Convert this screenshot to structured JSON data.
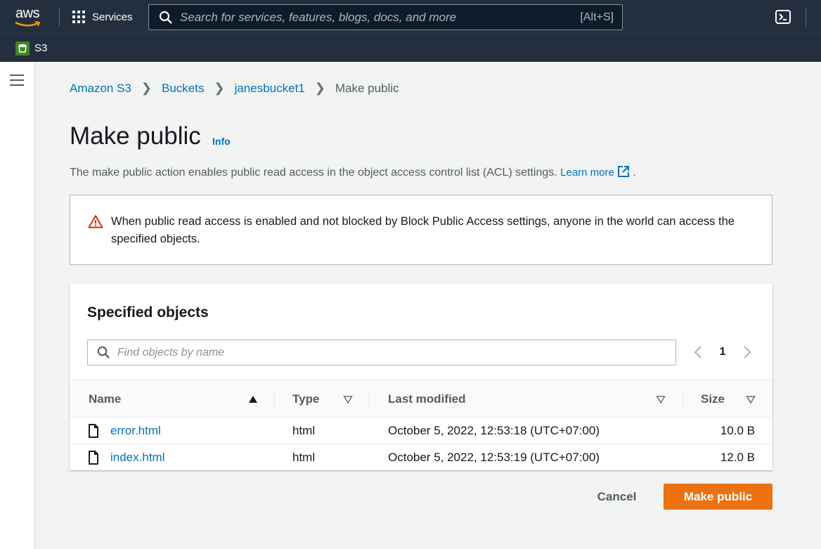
{
  "topnav": {
    "logo_text": "aws",
    "services_label": "Services",
    "search_placeholder": "Search for services, features, blogs, docs, and more",
    "search_shortcut": "[Alt+S]",
    "icons": [
      "grid-icon",
      "search-icon",
      "cloudshell-icon"
    ]
  },
  "subnav": {
    "service_label": "S3",
    "service_color": "#3f8624"
  },
  "breadcrumb": {
    "items": [
      "Amazon S3",
      "Buckets",
      "janesbucket1"
    ],
    "current": "Make public"
  },
  "page": {
    "title": "Make public",
    "info_label": "Info",
    "description": "The make public action enables public read access in the object access control list (ACL) settings.",
    "learn_more": "Learn more",
    "trailing_period": "."
  },
  "warning": {
    "text": "When public read access is enabled and not blocked by Block Public Access settings, anyone in the world can access the specified objects.",
    "color": "#d13212"
  },
  "objects": {
    "title": "Specified objects",
    "search_placeholder": "Find objects by name",
    "page_number": "1",
    "columns": [
      "Name",
      "Type",
      "Last modified",
      "Size"
    ],
    "rows": [
      {
        "name": "error.html",
        "type": "html",
        "modified": "October 5, 2022, 12:53:18 (UTC+07:00)",
        "size": "10.0 B"
      },
      {
        "name": "index.html",
        "type": "html",
        "modified": "October 5, 2022, 12:53:19 (UTC+07:00)",
        "size": "12.0 B"
      }
    ]
  },
  "actions": {
    "cancel": "Cancel",
    "primary": "Make public",
    "primary_color": "#ec7211"
  }
}
